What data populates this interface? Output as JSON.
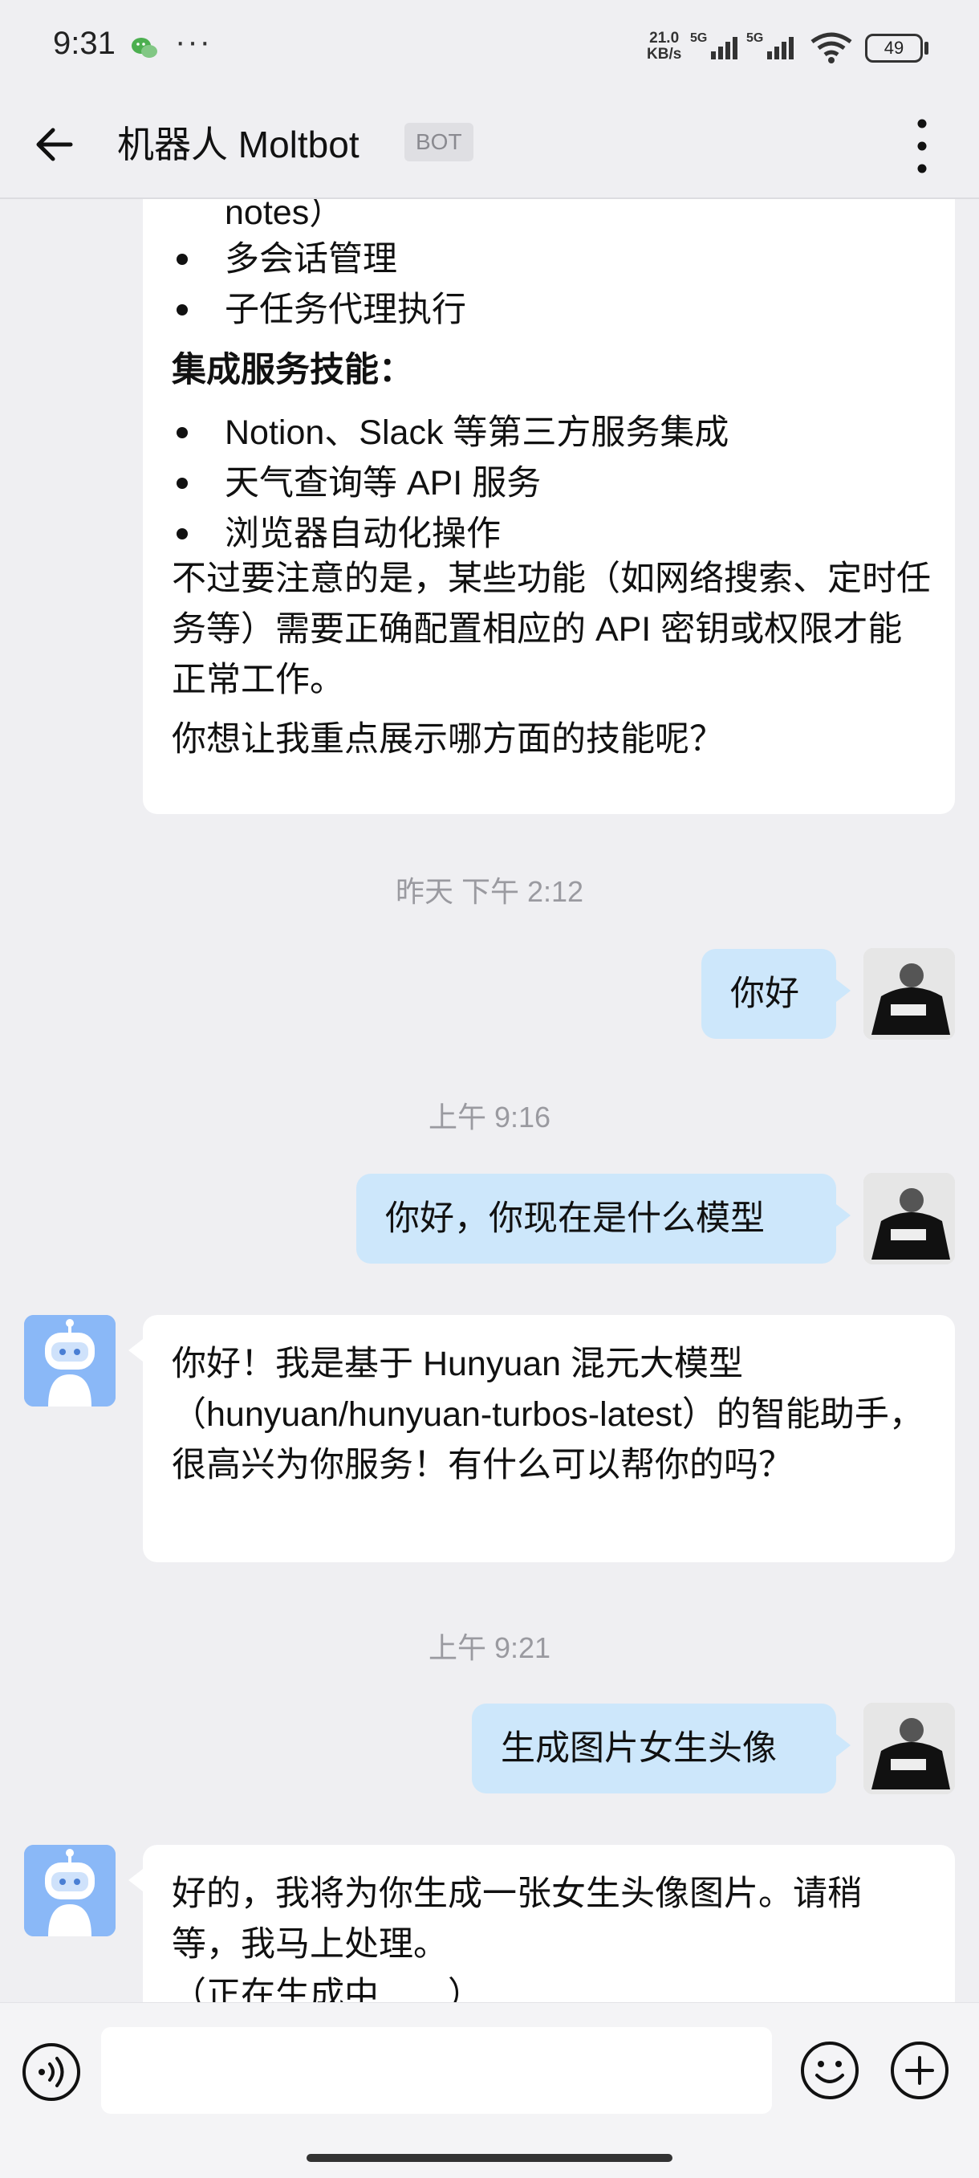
{
  "status_bar": {
    "time": "9:31",
    "dots": "···",
    "net_speed_value": "21.0",
    "net_speed_unit": "KB/s",
    "signal1_label": "5G",
    "signal2_label": "5G",
    "battery": "49",
    "icons": [
      "wechat-icon",
      "signal-icon",
      "wifi-icon",
      "battery-icon"
    ]
  },
  "header": {
    "title": "机器人 Moltbot",
    "badge": "BOT",
    "icons": [
      "back-arrow-icon",
      "more-vertical-icon"
    ]
  },
  "messages": {
    "m1": {
      "partial_top": "notes）",
      "bullets_a": [
        "多会话管理",
        "子任务代理执行"
      ],
      "heading": "集成服务技能：",
      "bullets_b": [
        "Notion、Slack 等第三方服务集成",
        "天气查询等 API 服务",
        "浏览器自动化操作"
      ],
      "para": "不过要注意的是，某些功能（如网络搜索、定时任务等）需要正确配置相应的 API 密钥或权限才能正常工作。",
      "question": "你想让我重点展示哪方面的技能呢？"
    },
    "ts1": "昨天  下午 2:12",
    "u1": "你好",
    "ts2": "上午 9:16",
    "u2": "你好，你现在是什么模型",
    "b1": "你好！我是基于 Hunyuan 混元大模型（hunyuan/hunyuan-turbos-latest）的智能助手，很高兴为你服务！有什么可以帮你的吗？",
    "ts3": "上午 9:21",
    "u3": "生成图片女生头像",
    "b2": "好的，我将为你生成一张女生头像图片。请稍等，我马上处理。",
    "b2_partial": "（正在生成中……）"
  },
  "input": {
    "value": "",
    "placeholder": "",
    "icons": [
      "voice-icon",
      "emoji-icon",
      "plus-icon"
    ]
  },
  "colors": {
    "background": "#efeff2",
    "user_bubble": "#cde7fb",
    "bot_bubble": "#ffffff",
    "bot_avatar": "#8ab8f7"
  }
}
